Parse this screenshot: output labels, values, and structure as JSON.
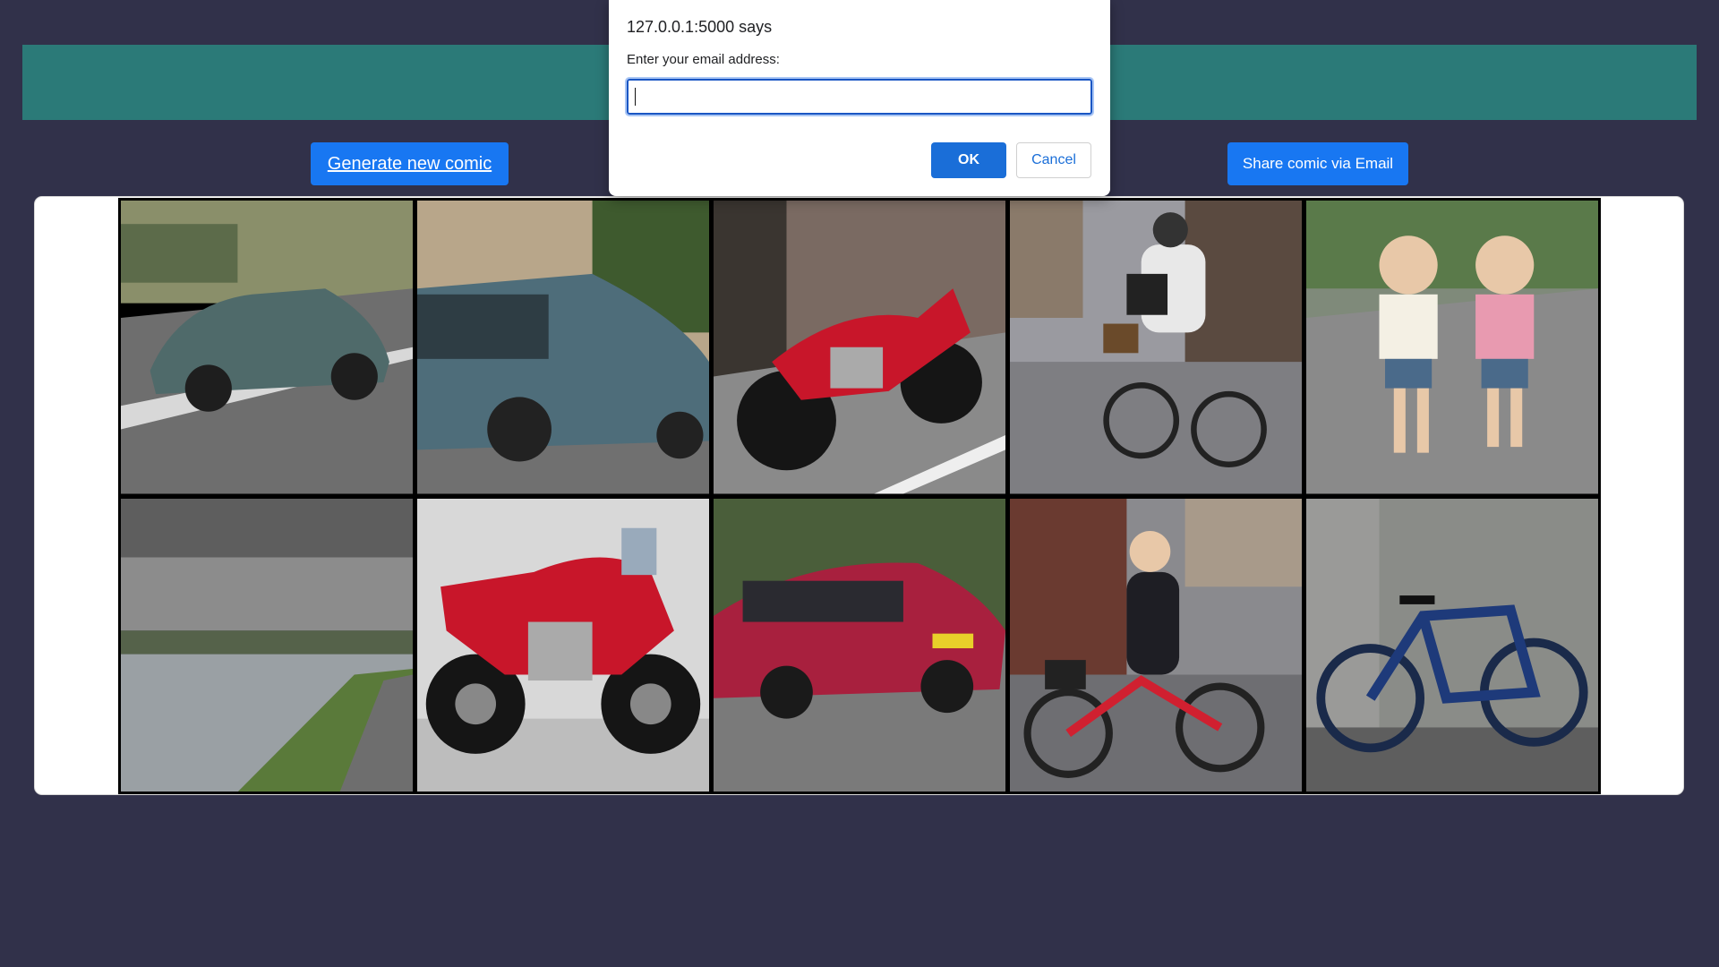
{
  "page": {
    "background": "#31314a",
    "header_color": "#2b7a78",
    "accent": "#1877f2"
  },
  "toolbar": {
    "generate_label": "Generate new comic",
    "share_label": "Share comic via Email"
  },
  "dialog": {
    "origin": "127.0.0.1:5000 says",
    "message": "Enter your email address:",
    "input_value": "",
    "ok_label": "OK",
    "cancel_label": "Cancel"
  },
  "comic": {
    "panels": [
      {
        "subject": "teal-vintage-sedan-on-road"
      },
      {
        "subject": "teal-vintage-sedan-in-street"
      },
      {
        "subject": "red-motorcycle-on-street"
      },
      {
        "subject": "cyclist-with-basket-on-street"
      },
      {
        "subject": "two-children-running"
      },
      {
        "subject": "cloudy-river-landscape"
      },
      {
        "subject": "red-sport-motorcycle-studio"
      },
      {
        "subject": "red-sedan-driving"
      },
      {
        "subject": "woman-on-red-bicycle"
      },
      {
        "subject": "blue-road-bike-against-wall"
      }
    ]
  }
}
